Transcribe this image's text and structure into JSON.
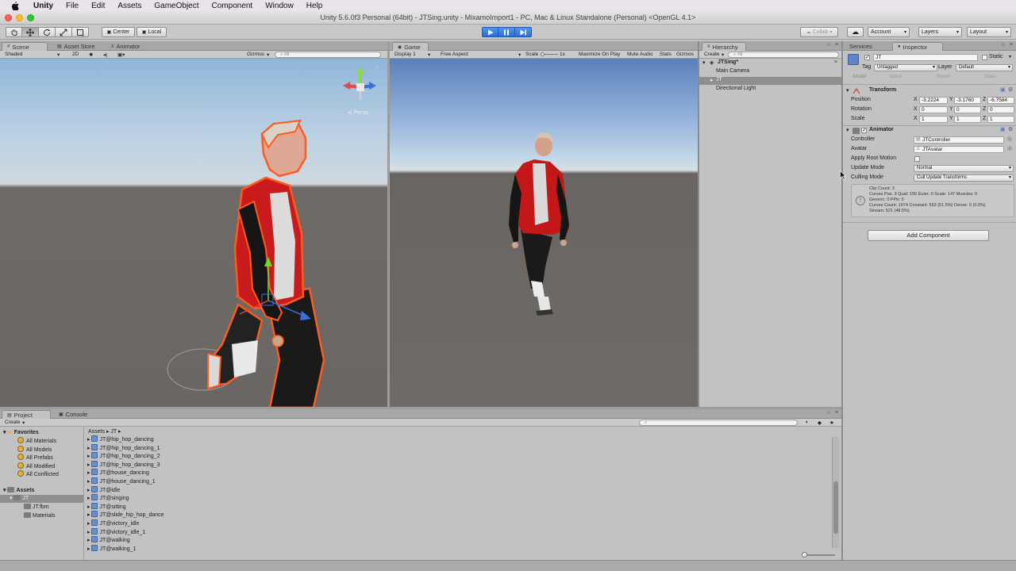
{
  "menubar": {
    "app": "Unity",
    "items": [
      "File",
      "Edit",
      "Assets",
      "GameObject",
      "Component",
      "Window",
      "Help"
    ]
  },
  "window": {
    "title": "Unity 5.6.0f3 Personal (64bit) - JTSing.unity - MixamoImport1 - PC, Mac & Linux Standalone (Personal) <OpenGL 4.1>"
  },
  "toolbar": {
    "pivot": "Center",
    "space": "Local",
    "collab": "Collab",
    "account": "Account",
    "layers": "Layers",
    "layout": "Layout"
  },
  "scene": {
    "tabs": [
      "Scene",
      "Asset Store",
      "Animator"
    ],
    "shading": "Shaded",
    "mode_2d": "2D",
    "gizmos": "Gizmos",
    "search_placeholder": "All",
    "persp": "Persp"
  },
  "game": {
    "tab": "Game",
    "display": "Display 1",
    "aspect": "Free Aspect",
    "scale_label": "Scale",
    "scale_value": "1x",
    "maximize": "Maximize On Play",
    "mute": "Mute Audio",
    "stats": "Stats",
    "gizmos": "Gizmos"
  },
  "hierarchy": {
    "tab": "Hierarchy",
    "create": "Create",
    "search_placeholder": "All",
    "scene_name": "JTSing*",
    "items": [
      "Main Camera",
      "JT",
      "Directional Light"
    ]
  },
  "inspector": {
    "tabs": [
      "Services",
      "Inspector"
    ],
    "object_name": "JT",
    "static_label": "Static",
    "tag_label": "Tag",
    "tag_value": "Untagged",
    "layer_label": "Layer",
    "layer_value": "Default",
    "model_label": "Model",
    "select": "Select",
    "revert": "Revert",
    "open": "Open",
    "transform": {
      "title": "Transform",
      "position_label": "Position",
      "rotation_label": "Rotation",
      "scale_label": "Scale",
      "position": [
        "-3.2224",
        "-3.1760",
        "-6.7584"
      ],
      "rotation": [
        "0",
        "0",
        "0"
      ],
      "scale": [
        "1",
        "1",
        "1"
      ],
      "axes": [
        "X",
        "Y",
        "Z"
      ]
    },
    "animator": {
      "title": "Animator",
      "controller_label": "Controller",
      "controller_value": "JTController",
      "avatar_label": "Avatar",
      "avatar_value": "JTAvatar",
      "root_motion_label": "Apply Root Motion",
      "update_mode_label": "Update Mode",
      "update_mode_value": "Normal",
      "culling_mode_label": "Culling Mode",
      "culling_mode_value": "Cull Update Transforms",
      "info": [
        "Clip Count: 3",
        "Curves Pos: 3 Quat: 156 Euler: 0 Scale: 147 Muscles: 0",
        "Generic: 0 PPtr: 0",
        "Curves Count: 1074 Constant: 553 (51.5%) Dense: 0 (0.0%)",
        "Stream: 521 (48.5%)"
      ]
    },
    "add_component": "Add Component"
  },
  "project": {
    "tabs": [
      "Project",
      "Console"
    ],
    "create": "Create",
    "favorites_label": "Favorites",
    "favorites": [
      "All Materials",
      "All Models",
      "All Prefabs",
      "All Modified",
      "All Conflicted"
    ],
    "assets_label": "Assets",
    "tree": [
      "JT",
      "JT.fbm",
      "Materials"
    ],
    "breadcrumb": [
      "Assets",
      "JT"
    ],
    "files": [
      "JT@hip_hop_dancing",
      "JT@hip_hop_dancing_1",
      "JT@hip_hop_dancing_2",
      "JT@hip_hop_dancing_3",
      "JT@house_dancing",
      "JT@house_dancing_1",
      "JT@idle",
      "JT@singing",
      "JT@sitting",
      "JT@slide_hip_hop_dance",
      "JT@victory_idle",
      "JT@victory_idle_1",
      "JT@walking",
      "JT@walking_1"
    ]
  },
  "colors": {
    "play_accent": "#2a6fd6",
    "selection": "#8f8f8f",
    "outline": "#ff5a1f"
  }
}
